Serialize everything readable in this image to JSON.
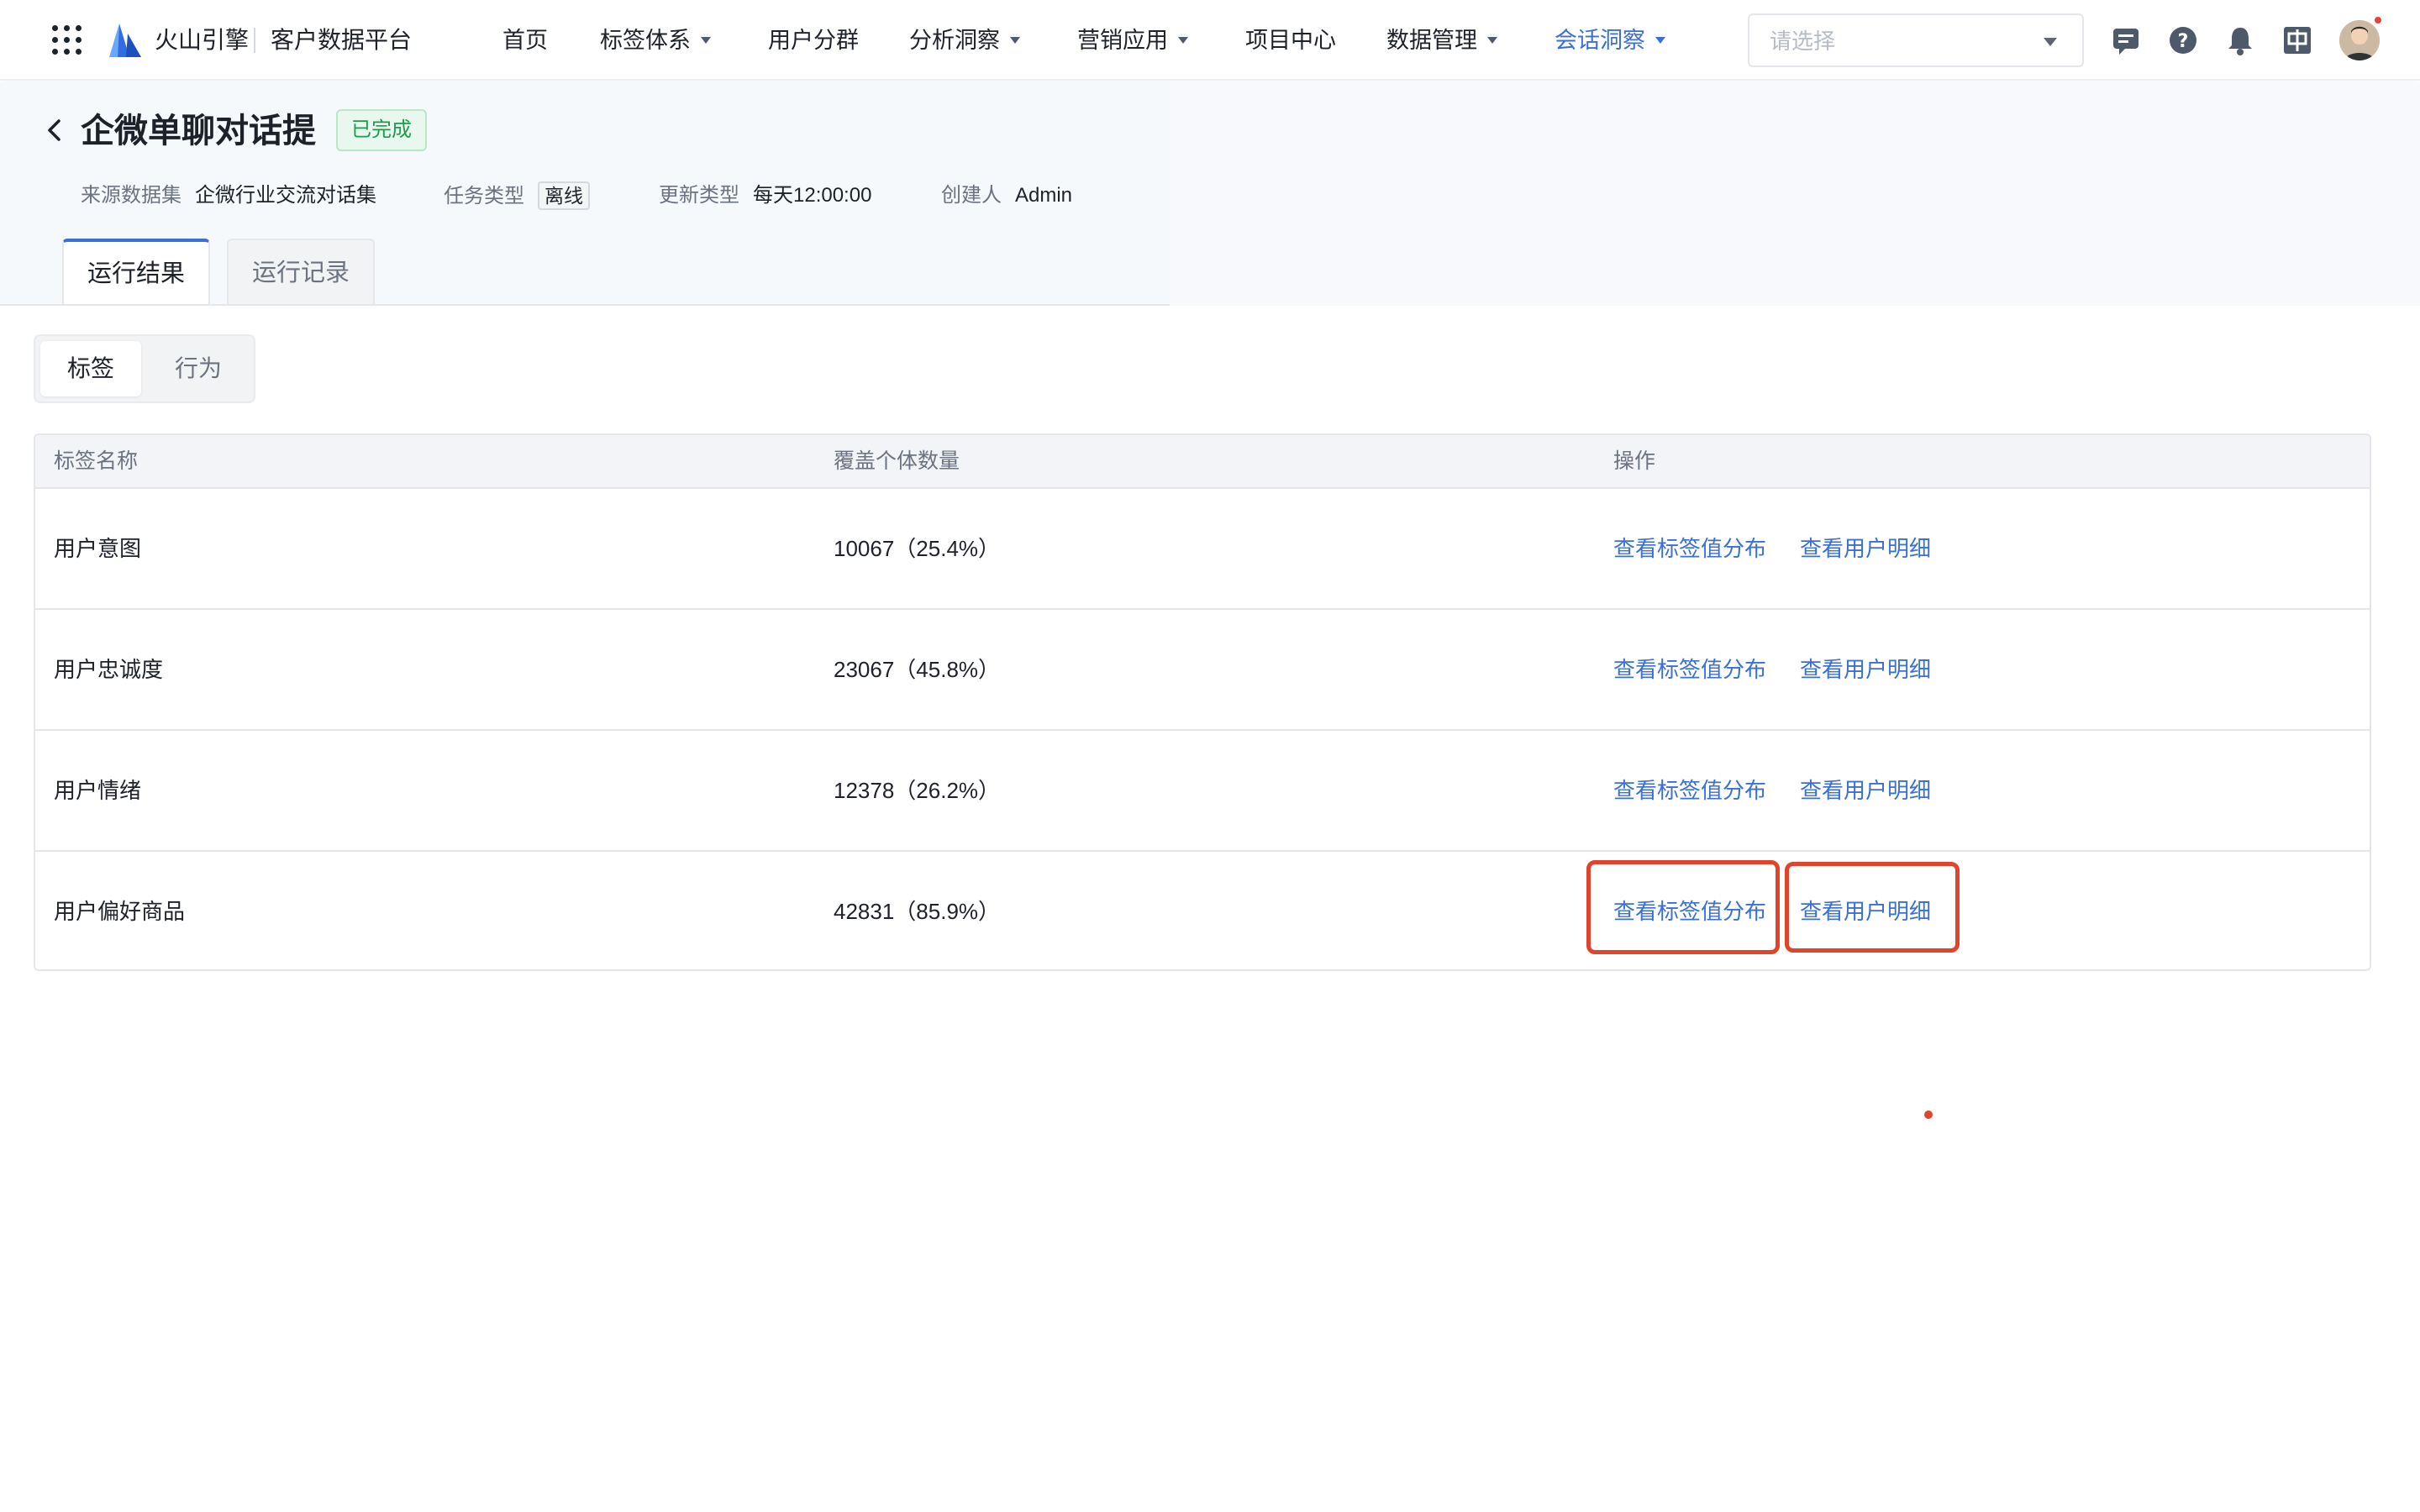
{
  "nav": {
    "brand": "火山引擎",
    "product": "客户数据平台",
    "items": [
      {
        "label": "首页",
        "has_caret": false,
        "active": false
      },
      {
        "label": "标签体系",
        "has_caret": true,
        "active": false
      },
      {
        "label": "用户分群",
        "has_caret": false,
        "active": false
      },
      {
        "label": "分析洞察",
        "has_caret": true,
        "active": false
      },
      {
        "label": "营销应用",
        "has_caret": true,
        "active": false
      },
      {
        "label": "项目中心",
        "has_caret": false,
        "active": false
      },
      {
        "label": "数据管理",
        "has_caret": true,
        "active": false
      },
      {
        "label": "会话洞察",
        "has_caret": true,
        "active": true
      }
    ],
    "project_select_placeholder": "请选择",
    "icons": [
      "message-icon",
      "help-icon",
      "bell-icon",
      "language-icon",
      "avatar"
    ],
    "accent_color": "#3a6fd6"
  },
  "page": {
    "title": "企微单聊对话提",
    "status": "已完成",
    "meta": {
      "source_label": "来源数据集",
      "source_value": "企微行业交流对话集",
      "task_type_label": "任务类型",
      "task_type_value": "离线",
      "update_type_label": "更新类型",
      "update_type_value": "每天12:00:00",
      "creator_label": "创建人",
      "creator_value": "Admin"
    },
    "tabs": {
      "active": "运行结果",
      "inactive": "运行记录"
    }
  },
  "segment": {
    "active": "标签",
    "inactive": "行为"
  },
  "table": {
    "headers": {
      "name": "标签名称",
      "count": "覆盖个体数量",
      "action": "操作"
    },
    "rows": [
      {
        "name": "用户意图",
        "count": "10067（25.4%）",
        "action1": "查看标签值分布",
        "action2": "查看用户明细"
      },
      {
        "name": "用户忠诚度",
        "count": "23067（45.8%）",
        "action1": "查看标签值分布",
        "action2": "查看用户明细"
      },
      {
        "name": "用户情绪",
        "count": "12378（26.2%）",
        "action1": "查看标签值分布",
        "action2": "查看用户明细"
      },
      {
        "name": "用户偏好商品",
        "count": "42831（85.9%）",
        "action1": "查看标签值分布",
        "action2": "查看用户明细"
      }
    ]
  }
}
